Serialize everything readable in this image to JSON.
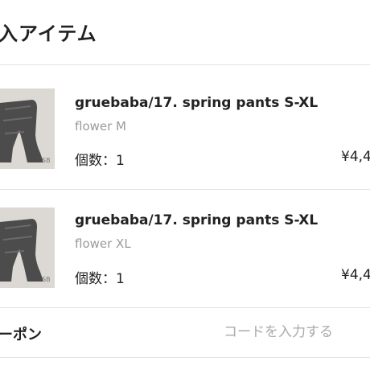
{
  "section": {
    "title": "入アイテム"
  },
  "items": [
    {
      "name": "gruebaba/17. spring pants S-XL",
      "variant": "flower M",
      "qty_label": "個数：1",
      "price": "¥4,4",
      "thumb_mark": "SB"
    },
    {
      "name": "gruebaba/17. spring pants S-XL",
      "variant": "flower XL",
      "qty_label": "個数：1",
      "price": "¥4,4",
      "thumb_mark": "SB"
    }
  ],
  "coupon": {
    "label": "ーポン",
    "placeholder": "コードを入力する"
  }
}
